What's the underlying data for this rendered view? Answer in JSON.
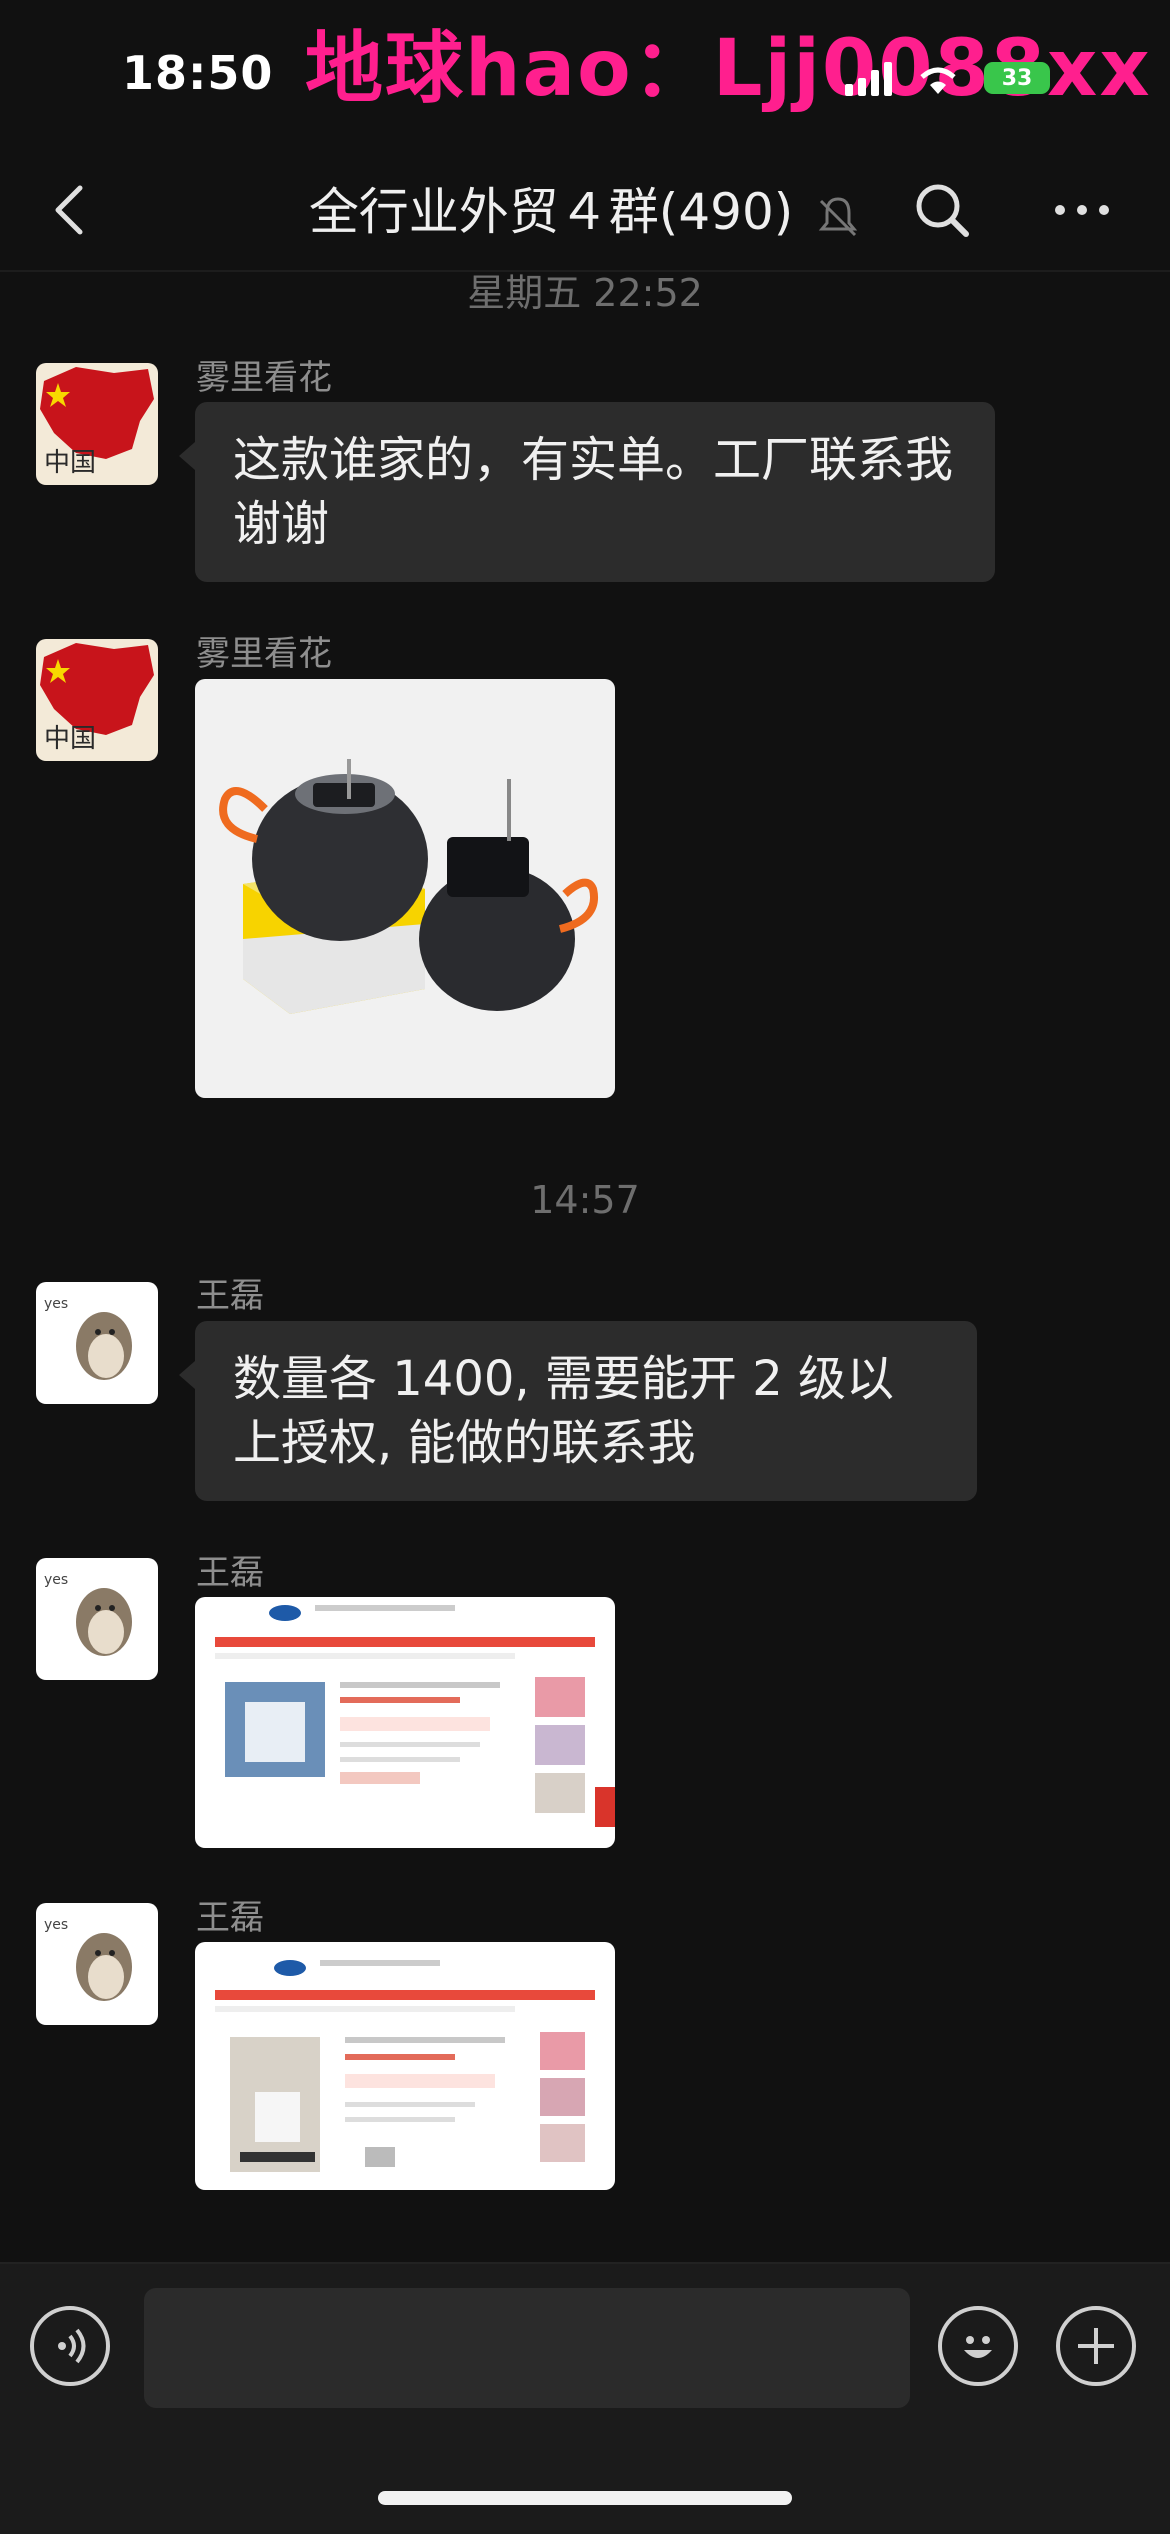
{
  "status_bar": {
    "time": "18:50",
    "battery": "33",
    "watermark": "地球hao：Ljj0088xx"
  },
  "header": {
    "title": "全行业外贸４群(490)"
  },
  "messages": {
    "ts1": "星期五 22:52",
    "m1": {
      "sender": "雾里看花",
      "text": "这款谁家的，有实单。工厂联系我谢谢"
    },
    "m2": {
      "sender": "雾里看花"
    },
    "ts2": "14:57",
    "m3": {
      "sender": "王磊",
      "text": "数量各 1400, 需要能开 2 级以上授权, 能做的联系我"
    },
    "m4": {
      "sender": "王磊"
    },
    "m5": {
      "sender": "王磊"
    }
  },
  "avatar_text": {
    "china": "中国",
    "yes": "yes"
  },
  "icons": [
    "back-icon",
    "mute-icon",
    "search-icon",
    "more-icon",
    "voice-icon",
    "emoji-icon",
    "plus-icon"
  ],
  "colors": {
    "background": "#111111",
    "bubble": "#2c2c2c",
    "watermark": "#ff1f8e",
    "battery": "#39c64b"
  }
}
